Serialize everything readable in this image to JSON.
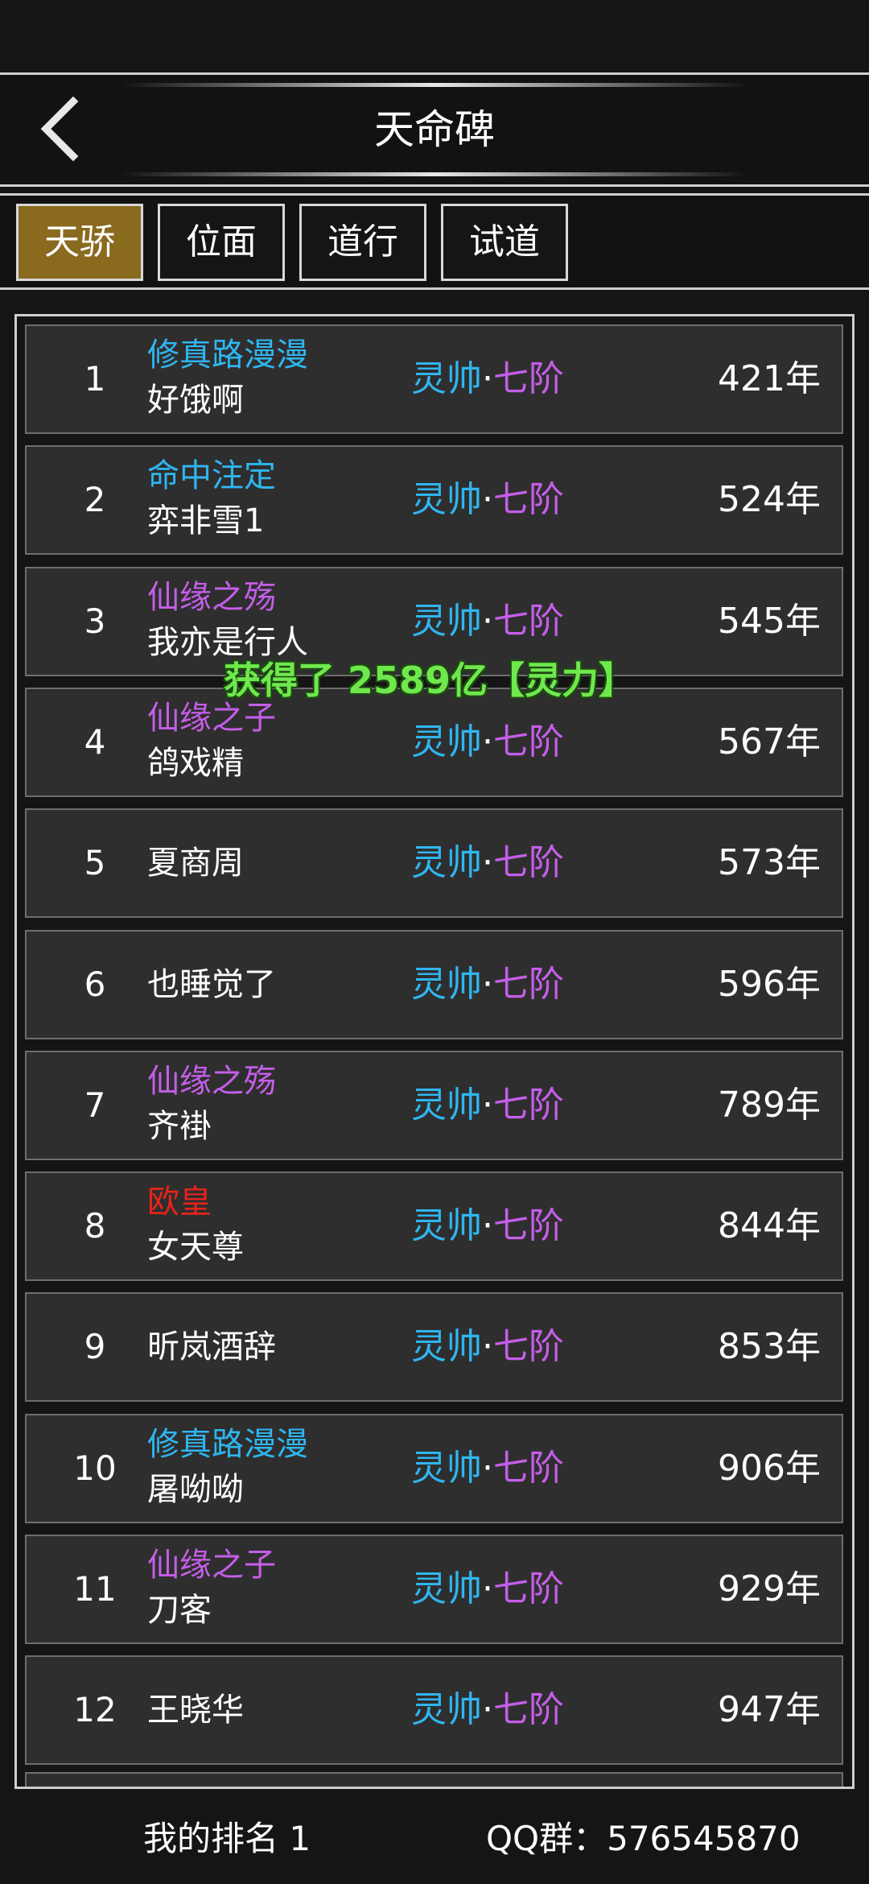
{
  "header": {
    "title": "天命碑",
    "back_icon": "chevron-left-icon"
  },
  "tabs": [
    {
      "label": "天骄",
      "active": true
    },
    {
      "label": "位面",
      "active": false
    },
    {
      "label": "道行",
      "active": false
    },
    {
      "label": "试道",
      "active": false
    }
  ],
  "colors": {
    "guild_cyan": "#2fb6f0",
    "guild_purple": "#c45ee8",
    "guild_red": "#e8231b",
    "realm_primary": "#2fb6f0",
    "realm_secondary": "#c45ee8",
    "active_tab": "#8a6a1f",
    "toast": "#6fe84d"
  },
  "rows": [
    {
      "rank": "1",
      "guild": "修真路漫漫",
      "guild_color": "cyan",
      "player": "好饿啊",
      "realm": "灵帅",
      "sep": "·",
      "stage": "七阶",
      "years": "421年"
    },
    {
      "rank": "2",
      "guild": "命中注定",
      "guild_color": "cyan",
      "player": "弈非雪1",
      "realm": "灵帅",
      "sep": "·",
      "stage": "七阶",
      "years": "524年"
    },
    {
      "rank": "3",
      "guild": "仙缘之殇",
      "guild_color": "purple",
      "player": "我亦是行人",
      "realm": "灵帅",
      "sep": "·",
      "stage": "七阶",
      "years": "545年"
    },
    {
      "rank": "4",
      "guild": "仙缘之子",
      "guild_color": "purple",
      "player": "鸽戏精",
      "realm": "灵帅",
      "sep": "·",
      "stage": "七阶",
      "years": "567年"
    },
    {
      "rank": "5",
      "guild": "",
      "guild_color": "",
      "player": "夏商周",
      "realm": "灵帅",
      "sep": "·",
      "stage": "七阶",
      "years": "573年"
    },
    {
      "rank": "6",
      "guild": "",
      "guild_color": "",
      "player": "也睡觉了",
      "realm": "灵帅",
      "sep": "·",
      "stage": "七阶",
      "years": "596年"
    },
    {
      "rank": "7",
      "guild": "仙缘之殇",
      "guild_color": "purple",
      "player": "齐褂",
      "realm": "灵帅",
      "sep": "·",
      "stage": "七阶",
      "years": "789年"
    },
    {
      "rank": "8",
      "guild": "欧皇",
      "guild_color": "red",
      "player": "女天尊",
      "realm": "灵帅",
      "sep": "·",
      "stage": "七阶",
      "years": "844年"
    },
    {
      "rank": "9",
      "guild": "",
      "guild_color": "",
      "player": "昕岚酒辞",
      "realm": "灵帅",
      "sep": "·",
      "stage": "七阶",
      "years": "853年"
    },
    {
      "rank": "10",
      "guild": "修真路漫漫",
      "guild_color": "cyan",
      "player": "屠呦呦",
      "realm": "灵帅",
      "sep": "·",
      "stage": "七阶",
      "years": "906年"
    },
    {
      "rank": "11",
      "guild": "仙缘之子",
      "guild_color": "purple",
      "player": "刀客",
      "realm": "灵帅",
      "sep": "·",
      "stage": "七阶",
      "years": "929年"
    },
    {
      "rank": "12",
      "guild": "",
      "guild_color": "",
      "player": "王晓华",
      "realm": "灵帅",
      "sep": "·",
      "stage": "七阶",
      "years": "947年"
    }
  ],
  "toast": "获得了 2589亿【灵力】",
  "footer": {
    "my_rank": "我的排名 1",
    "qq_group": "QQ群：576545870"
  }
}
